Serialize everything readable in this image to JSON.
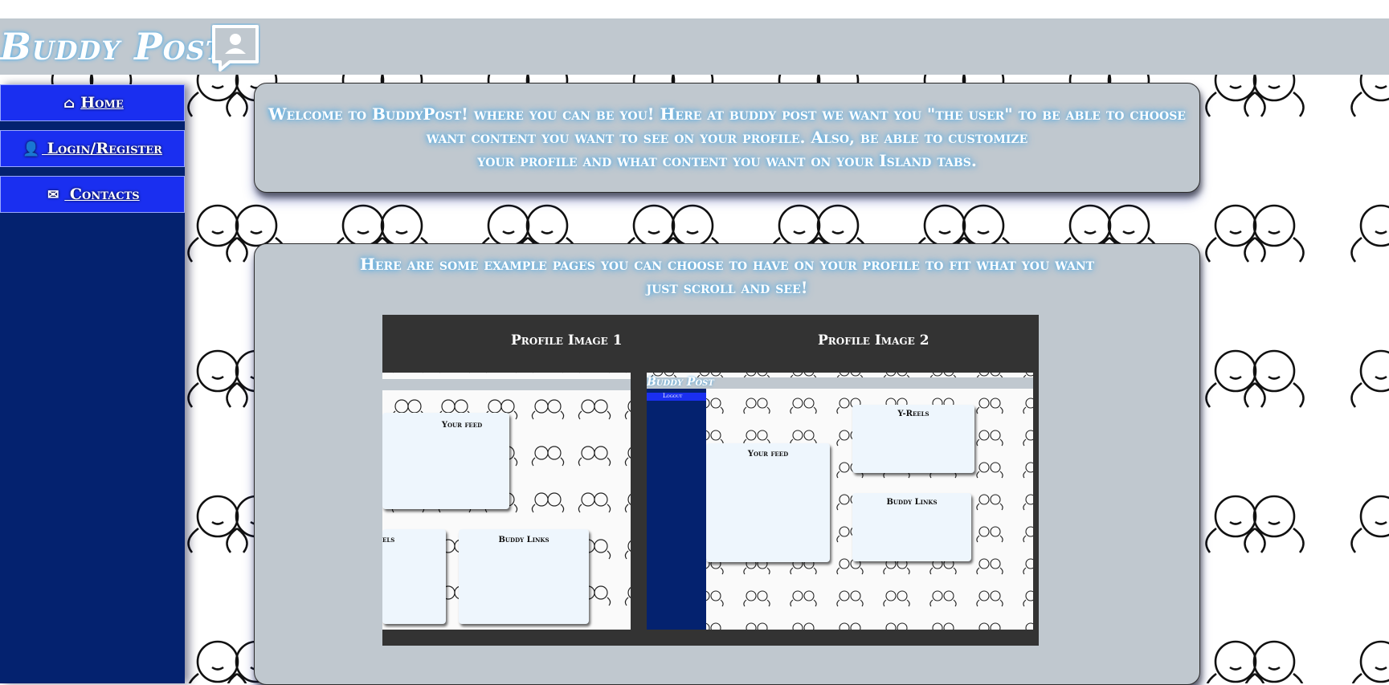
{
  "header": {
    "logo_text": "Buddy Post"
  },
  "sidebar": {
    "items": [
      {
        "icon": "home-icon",
        "glyph": "⌂",
        "label": "Home"
      },
      {
        "icon": "user-icon",
        "glyph": "👤",
        "label": " Login/Register"
      },
      {
        "icon": "envelope-icon",
        "glyph": "✉",
        "label": " Contacts"
      }
    ]
  },
  "welcome": {
    "line1": "Welcome to BuddyPost! where you can be you! Here at buddy post we want you \"the user\" to be able to choose",
    "line2": "want content you want to see on your profile. Also, be able to customize",
    "line3": "your profile and what content you want on your Island tabs."
  },
  "examples": {
    "line1": "Here are some example pages you can choose to have on your profile to fit what you want",
    "line2": "just scroll and see!"
  },
  "gallery": {
    "image1_title": "Profile Image 1",
    "image2_title": "Profile Image 2",
    "image1": {
      "feed_label": "Your feed",
      "reels_label": "els",
      "links_label": "Buddy Links"
    },
    "image2": {
      "logo": "Buddy Post",
      "logout_label": "Logout",
      "feed_label": "Your feed",
      "reels_label": "Y-Reels",
      "links_label": "Buddy Links"
    }
  },
  "colors": {
    "header_bg": "#c0c8cf",
    "sidebar_bg": "#04226f",
    "nav_button_bg": "#1a2ff0",
    "panel_bg": "#c0c8cf",
    "gallery_bg": "#333333",
    "text_glow": "#4aa9e6"
  }
}
